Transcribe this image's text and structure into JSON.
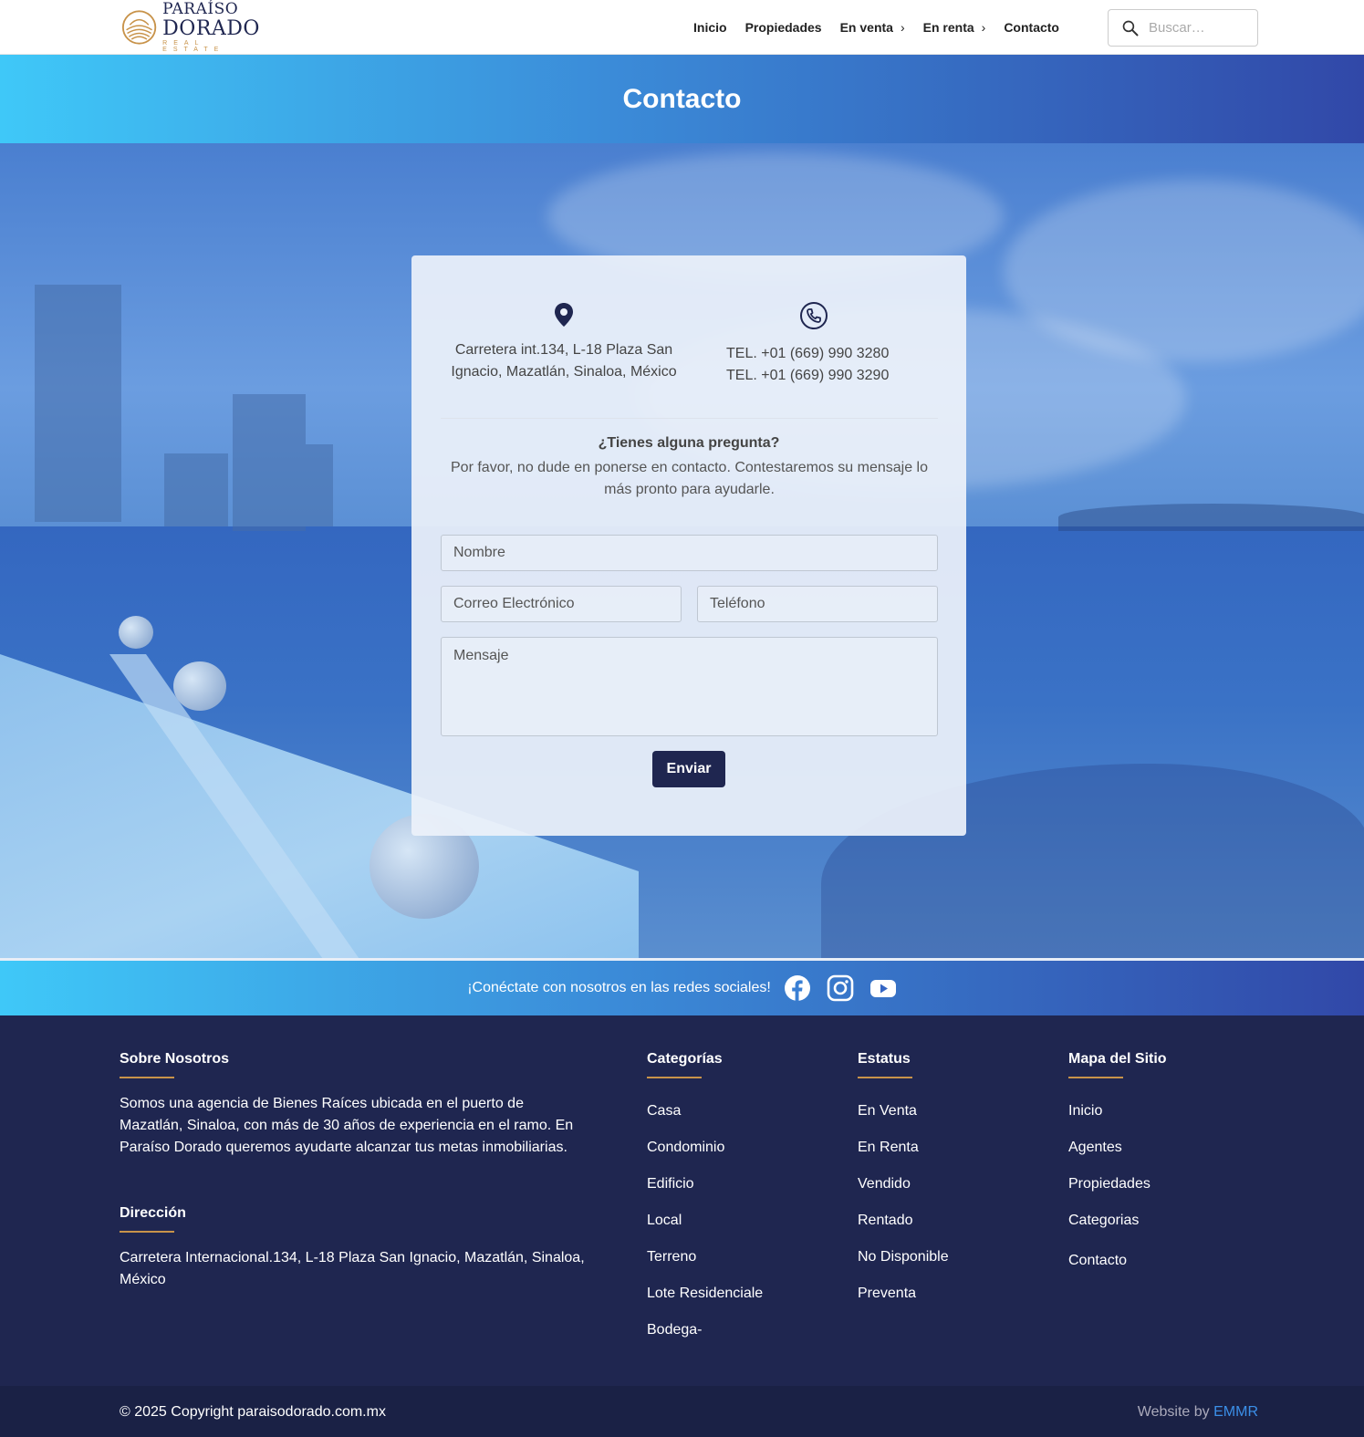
{
  "brand": {
    "line1": "PARAÍSO",
    "line2": "DORADO",
    "line3": "REAL ESTATE"
  },
  "nav": {
    "items": [
      {
        "label": "Inicio"
      },
      {
        "label": "Propiedades"
      },
      {
        "label": "En venta"
      },
      {
        "label": "En renta"
      },
      {
        "label": "Contacto"
      }
    ],
    "search_placeholder": "Buscar…"
  },
  "page": {
    "title": "Contacto"
  },
  "contact": {
    "address": "Carretera int.134, L-18 Plaza San Ignacio, Mazatlán, Sinaloa, México",
    "tel1": "TEL. +01 (669) 990 3280",
    "tel2": "TEL. +01 (669) 990 3290",
    "question_title": "¿Tienes alguna pregunta?",
    "question_text": "Por favor, no dude en ponerse en contacto. Contestaremos su mensaje lo más pronto para ayudarle."
  },
  "form": {
    "name_placeholder": "Nombre",
    "email_placeholder": "Correo Electrónico",
    "phone_placeholder": "Teléfono",
    "message_placeholder": "Mensaje",
    "submit_label": "Enviar"
  },
  "social": {
    "text": "¡Conéctate con nosotros en las redes sociales!",
    "icons": [
      "facebook-icon",
      "instagram-icon",
      "youtube-icon"
    ]
  },
  "footer": {
    "about": {
      "title": "Sobre Nosotros",
      "text": "Somos una agencia de Bienes Raíces ubicada en el puerto de Mazatlán, Sinaloa, con más de 30 años de experiencia en el ramo. En Paraíso Dorado queremos ayudarte alcanzar tus metas inmobiliarias."
    },
    "address": {
      "title": "Dirección",
      "text": "Carretera Internacional.134, L-18 Plaza San Ignacio, Mazatlán, Sinaloa, México"
    },
    "categories": {
      "title": "Categorías",
      "items": [
        "Casa",
        "Condominio",
        "Edificio",
        "Local",
        "Terreno",
        "Lote Residenciale",
        "Bodega-"
      ]
    },
    "status": {
      "title": "Estatus",
      "items": [
        "En Venta",
        "En Renta",
        "Vendido",
        "Rentado",
        "No Disponible",
        "Preventa"
      ]
    },
    "sitemap": {
      "title": "Mapa del Sitio",
      "items": [
        "Inicio",
        "Agentes",
        "Propiedades",
        "Categorias",
        "Contacto"
      ]
    },
    "copyright": "© 2025 Copyright paraisodorado.com.mx",
    "credit_prefix": "Website by",
    "credit_link": "EMMR"
  },
  "colors": {
    "navy": "#1f2650",
    "gold": "#c8934a",
    "gradient_start": "#3fc8f8",
    "gradient_end": "#3148a8",
    "credit_link": "#3b8fe8"
  }
}
